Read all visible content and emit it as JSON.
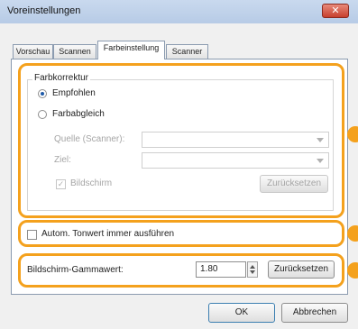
{
  "window": {
    "title": "Voreinstellungen",
    "close_symbol": "✕"
  },
  "tabs": [
    {
      "label": "Vorschau",
      "active": false
    },
    {
      "label": "Scannen",
      "active": false
    },
    {
      "label": "Farbeinstellung",
      "active": true
    },
    {
      "label": "Scanner",
      "active": false
    }
  ],
  "color_correction": {
    "title": "Farbkorrektur",
    "options": [
      {
        "label": "Empfohlen",
        "selected": true
      },
      {
        "label": "Farbabgleich",
        "selected": false
      }
    ],
    "source_label": "Quelle (Scanner):",
    "target_label": "Ziel:",
    "source_value": "",
    "target_value": "",
    "monitor_checkbox": {
      "label": "Bildschirm",
      "checked": true,
      "enabled": false
    },
    "reset_button": "Zurücksetzen"
  },
  "auto_tone": {
    "label": "Autom. Tonwert immer ausführen",
    "checked": false
  },
  "gamma": {
    "label": "Bildschirm-Gammawert:",
    "value": "1.80",
    "reset_button": "Zurücksetzen"
  },
  "footer": {
    "ok_label": "OK",
    "cancel_label": "Abbrechen"
  },
  "accent_color": "#f4a11d"
}
